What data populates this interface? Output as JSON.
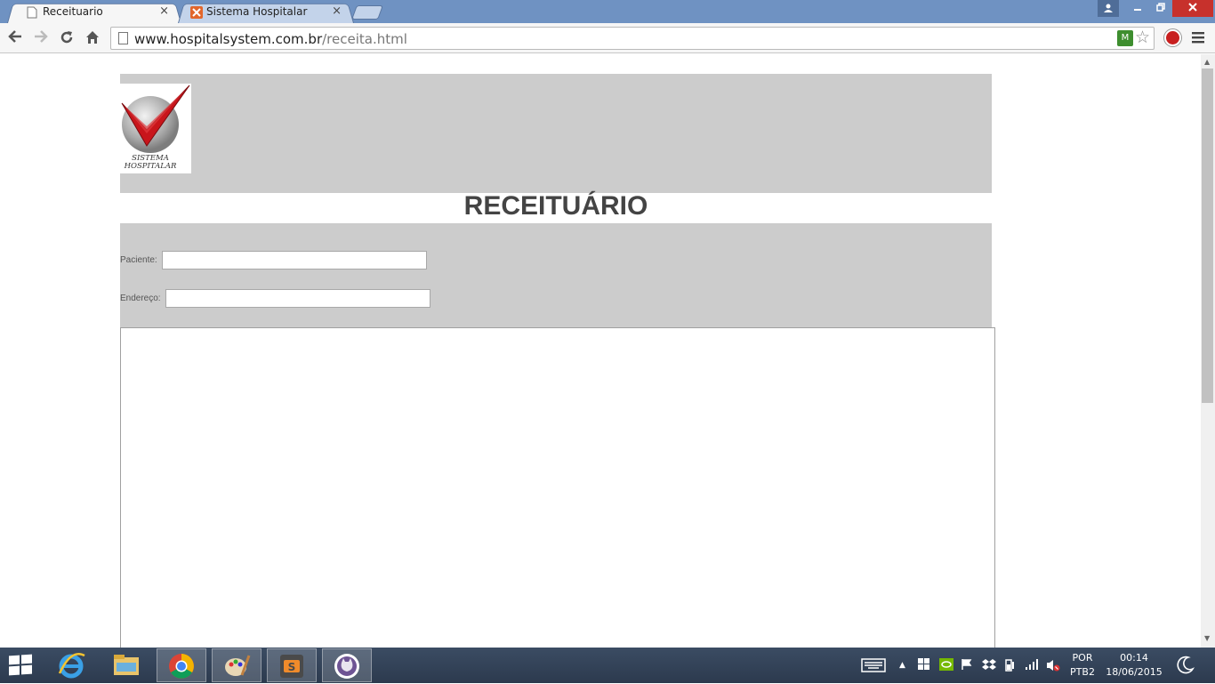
{
  "browser": {
    "tabs": [
      {
        "label": "Receituario",
        "active": true
      },
      {
        "label": "Sistema Hospitalar",
        "active": false
      }
    ],
    "tab_close_glyph": "×",
    "url_host": "www.hospitalsystem.com.br",
    "url_path": "/receita.html"
  },
  "page": {
    "logo_text_line1": "SISTEMA",
    "logo_text_line2": "HOSPITALAR",
    "title": "RECEITUÁRIO",
    "form": {
      "paciente_label": "Paciente:",
      "paciente_value": "",
      "endereco_label": "Endereço:",
      "endereco_value": ""
    }
  },
  "taskbar": {
    "language_line1": "POR",
    "language_line2": "PTB2",
    "time": "00:14",
    "date": "18/06/2015"
  },
  "colors": {
    "band_gray": "#cccccc",
    "title_text": "#444444",
    "logo_red": "#c8151b"
  }
}
